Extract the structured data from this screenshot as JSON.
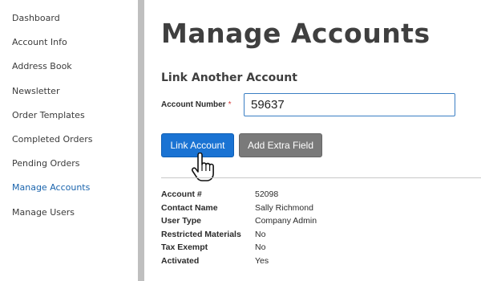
{
  "sidebar": {
    "items": [
      {
        "label": "Dashboard"
      },
      {
        "label": "Account Info"
      },
      {
        "label": "Address Book"
      },
      {
        "label": "Newsletter"
      },
      {
        "label": "Order Templates"
      },
      {
        "label": "Completed Orders"
      },
      {
        "label": "Pending Orders"
      },
      {
        "label": "Manage Accounts"
      },
      {
        "label": "Manage Users"
      }
    ],
    "active_color": "#1a64ad"
  },
  "main": {
    "title": "Manage Accounts",
    "section_title": "Link Another Account",
    "account_number_label": "Account Number",
    "required_marker": "*",
    "account_number_value": "59637",
    "link_button_label": "Link Account",
    "extra_field_button_label": "Add Extra Field",
    "details": [
      {
        "label": "Account #",
        "value": "52098"
      },
      {
        "label": "Contact Name",
        "value": "Sally Richmond"
      },
      {
        "label": "User Type",
        "value": "Company Admin"
      },
      {
        "label": "Restricted Materials",
        "value": "No"
      },
      {
        "label": "Tax Exempt",
        "value": "No"
      },
      {
        "label": "Activated",
        "value": "Yes"
      }
    ]
  },
  "cursor_icon": "hand-pointer-icon",
  "colors": {
    "primary_button": "#1a73d3",
    "secondary_button": "#7a7a7a",
    "required": "#d43a3a"
  }
}
